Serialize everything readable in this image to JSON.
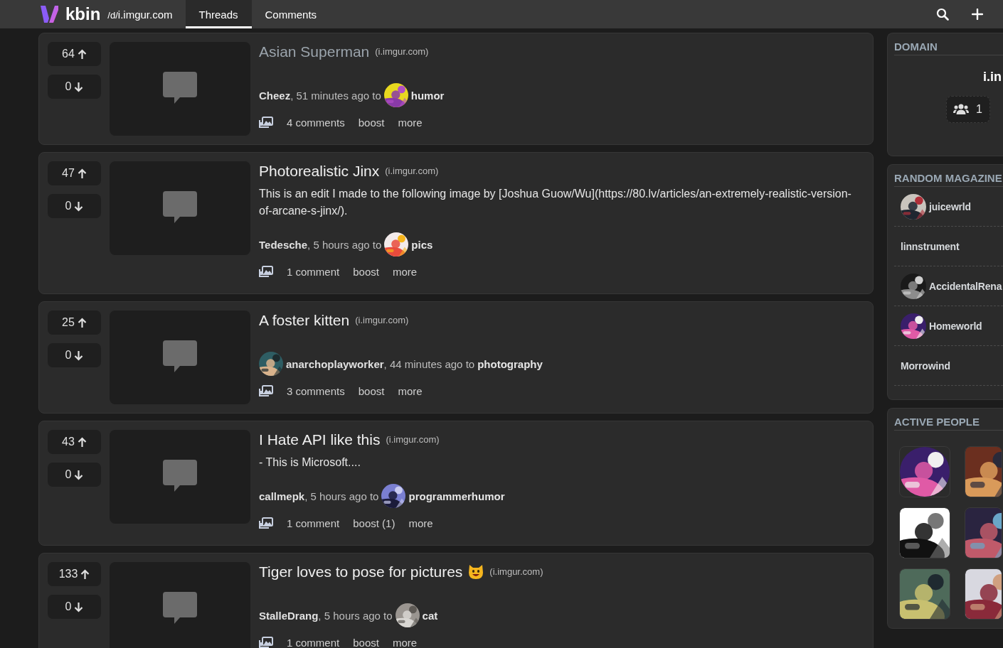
{
  "topbar": {
    "brand": "kbin",
    "path_prefix": "/d/",
    "path": "i.imgur.com",
    "tabs": [
      {
        "label": "Threads",
        "selected": true
      },
      {
        "label": "Comments",
        "selected": false
      }
    ]
  },
  "posts": [
    {
      "up": "64",
      "down": "0",
      "title": "Asian Superman",
      "visited": true,
      "title_emoji": false,
      "domain": "(i.imgur.com)",
      "author": "Cheez",
      "author_avatar": false,
      "time": ", 51 minutes ago to",
      "magazine_avatar": true,
      "magazine": "humor",
      "comments": "4 comments",
      "boost": "boost",
      "more": "more"
    },
    {
      "up": "47",
      "down": "0",
      "title": "Photorealistic Jinx",
      "visited": false,
      "title_emoji": false,
      "domain": "(i.imgur.com)",
      "body": "This is an edit I made to the following image by [Joshua Guow/Wu](https://80.lv/articles/an-extremely-realistic-version-of-arcane-s-jinx/).",
      "author": "Tedesche",
      "author_avatar": false,
      "time": ", 5 hours ago to",
      "magazine_avatar": true,
      "magazine": "pics",
      "comments": "1 comment",
      "boost": "boost",
      "more": "more"
    },
    {
      "up": "25",
      "down": "0",
      "title": "A foster kitten",
      "visited": false,
      "title_emoji": false,
      "domain": "(i.imgur.com)",
      "author": "anarchoplayworker",
      "author_avatar": true,
      "time": ", 44 minutes ago to",
      "magazine_avatar": false,
      "magazine": "photography",
      "comments": "3 comments",
      "boost": "boost",
      "more": "more"
    },
    {
      "up": "43",
      "down": "0",
      "title": "I Hate API like this",
      "visited": false,
      "title_emoji": false,
      "domain": "(i.imgur.com)",
      "body": "- This is Microsoft....",
      "author": "callmepk",
      "author_avatar": false,
      "time": ", 5 hours ago to",
      "magazine_avatar": true,
      "magazine": "programmerhumor",
      "comments": "1 comment",
      "boost": "boost (1)",
      "more": "more"
    },
    {
      "up": "133",
      "down": "0",
      "title": "Tiger loves to pose for pictures",
      "visited": false,
      "title_emoji": true,
      "domain": "(i.imgur.com)",
      "author": "StalleDrang",
      "author_avatar": false,
      "time": ", 5 hours ago to",
      "magazine_avatar": true,
      "magazine": "cat",
      "comments": "1 comment",
      "boost": "boost",
      "more": "more"
    }
  ],
  "sidebar": {
    "domain": {
      "heading": "DOMAIN",
      "name": "i.in",
      "subscribers": "1"
    },
    "random_magazines": {
      "heading": "RANDOM MAGAZINE",
      "items": [
        {
          "name": "juicewrld",
          "avatar": true
        },
        {
          "name": "linnstrument",
          "avatar": false
        },
        {
          "name": "AccidentalRena",
          "avatar": true
        },
        {
          "name": "Homeworld",
          "avatar": true
        },
        {
          "name": "Morrowind",
          "avatar": false
        }
      ]
    },
    "active_people": {
      "heading": "ACTIVE PEOPLE"
    }
  }
}
